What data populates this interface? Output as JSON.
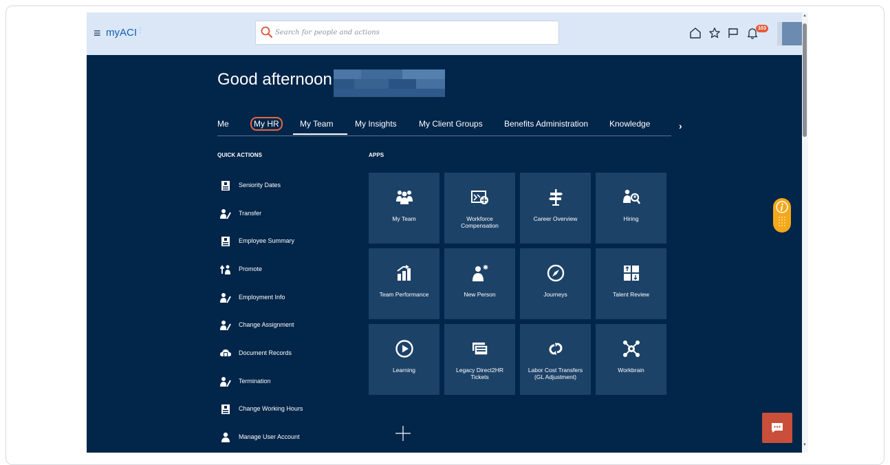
{
  "header": {
    "menu_icon": "hamburger-icon",
    "logo_text": "myACI",
    "search": {
      "placeholder": "Search for people and actions"
    },
    "icons": [
      "home-icon",
      "star-icon",
      "flag-icon",
      "bell-icon"
    ],
    "notification_count": "103"
  },
  "greeting": "Good afternoon,",
  "tabs": [
    {
      "label": "Me"
    },
    {
      "label": "My HR",
      "highlighted": true
    },
    {
      "label": "My Team",
      "active": true
    },
    {
      "label": "My Insights"
    },
    {
      "label": "My Client Groups"
    },
    {
      "label": "Benefits Administration"
    },
    {
      "label": "Knowledge"
    }
  ],
  "quick_actions": {
    "heading": "QUICK ACTIONS",
    "items": [
      {
        "label": "Seniority Dates",
        "icon": "id-badge-icon"
      },
      {
        "label": "Transfer",
        "icon": "person-edit-icon"
      },
      {
        "label": "Employee Summary",
        "icon": "id-badge-icon"
      },
      {
        "label": "Promote",
        "icon": "promote-icon"
      },
      {
        "label": "Employment Info",
        "icon": "person-edit-icon"
      },
      {
        "label": "Change Assignment",
        "icon": "person-edit-icon"
      },
      {
        "label": "Document Records",
        "icon": "cloud-document-icon"
      },
      {
        "label": "Termination",
        "icon": "person-edit-icon"
      },
      {
        "label": "Change Working Hours",
        "icon": "id-badge-icon"
      },
      {
        "label": "Manage User Account",
        "icon": "person-icon"
      }
    ]
  },
  "apps": {
    "heading": "APPS",
    "tiles": [
      {
        "label": "My Team",
        "icon": "team-icon"
      },
      {
        "label": "Workforce Compensation",
        "icon": "compensation-icon"
      },
      {
        "label": "Career Overview",
        "icon": "signpost-icon"
      },
      {
        "label": "Hiring",
        "icon": "hiring-icon"
      },
      {
        "label": "Team Performance",
        "icon": "performance-chart-icon"
      },
      {
        "label": "New Person",
        "icon": "new-person-icon"
      },
      {
        "label": "Journeys",
        "icon": "compass-icon"
      },
      {
        "label": "Talent Review",
        "icon": "talent-grid-icon"
      },
      {
        "label": "Learning",
        "icon": "play-icon"
      },
      {
        "label": "Legacy Direct2HR Tickets",
        "icon": "tickets-icon"
      },
      {
        "label": "Labor Cost Transfers (GL Adjustment)",
        "icon": "transfer-cycle-icon"
      },
      {
        "label": "Workbrain",
        "icon": "network-icon"
      }
    ]
  },
  "colors": {
    "topbar": "#dbe7f7",
    "page_background": "#02254a",
    "tile": "#1d4268",
    "tab_highlight": "#e66a3e",
    "help_widget": "#f5a81c",
    "chat_button": "#c94f3a"
  }
}
